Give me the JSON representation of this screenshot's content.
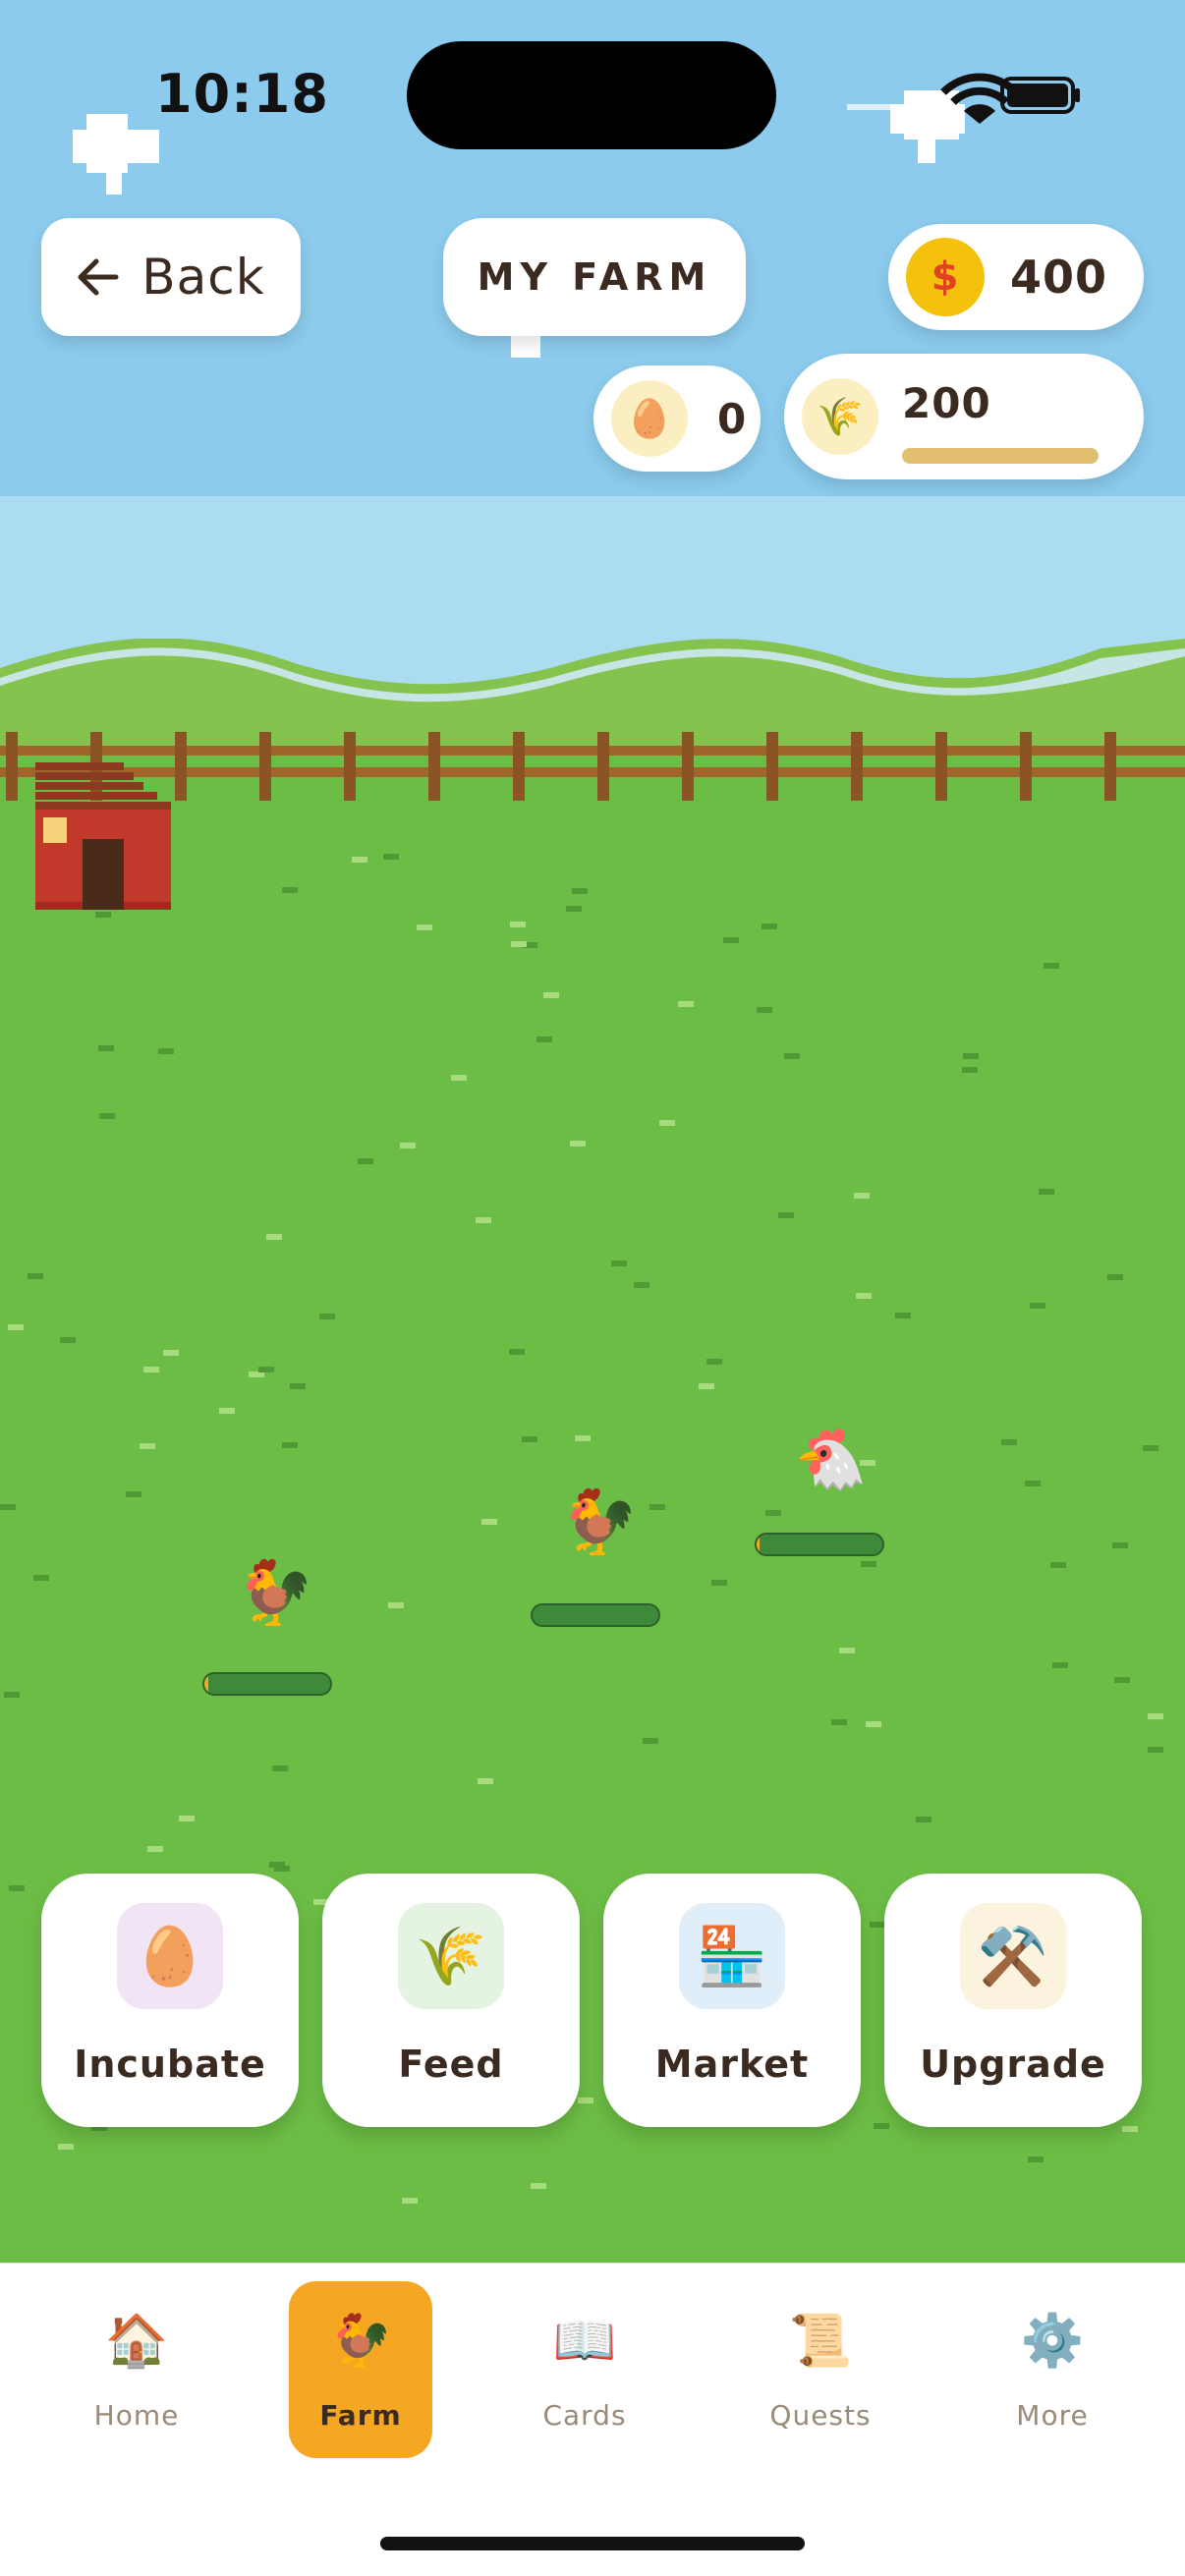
{
  "status_bar": {
    "time": "10:18"
  },
  "header": {
    "back_label": "Back",
    "title": "MY FARM",
    "coins": "400",
    "coin_symbol": "$",
    "eggs": "0",
    "feed": "200",
    "feed_level": 1.0
  },
  "chickens": [
    {
      "health": 0.03
    },
    {
      "health": 0.0
    },
    {
      "health": 0.02
    }
  ],
  "actions": [
    {
      "label": "Incubate",
      "icon": "egg-icon",
      "glyph": "🥚",
      "bg": "#f1e4f4"
    },
    {
      "label": "Feed",
      "icon": "rice-icon",
      "glyph": "🌾",
      "bg": "#e5f3e3"
    },
    {
      "label": "Market",
      "icon": "convenience-store-icon",
      "glyph": "🏪",
      "bg": "#e0eefa"
    },
    {
      "label": "Upgrade",
      "icon": "hammer-pick-icon",
      "glyph": "⚒️",
      "bg": "#fbf3dd"
    }
  ],
  "tabs": [
    {
      "label": "Home",
      "icon": "house-icon",
      "glyph": "🏠",
      "active": false
    },
    {
      "label": "Farm",
      "icon": "rooster-icon",
      "glyph": "🐓",
      "active": true
    },
    {
      "label": "Cards",
      "icon": "open-book-icon",
      "glyph": "📖",
      "active": false
    },
    {
      "label": "Quests",
      "icon": "scroll-icon",
      "glyph": "📜",
      "active": false
    },
    {
      "label": "More",
      "icon": "gear-icon",
      "glyph": "⚙️",
      "active": false
    }
  ],
  "colors": {
    "accent": "#f5a623",
    "sky": "#8ccbed",
    "grass": "#6cbd45",
    "text": "#3b2a1f"
  }
}
